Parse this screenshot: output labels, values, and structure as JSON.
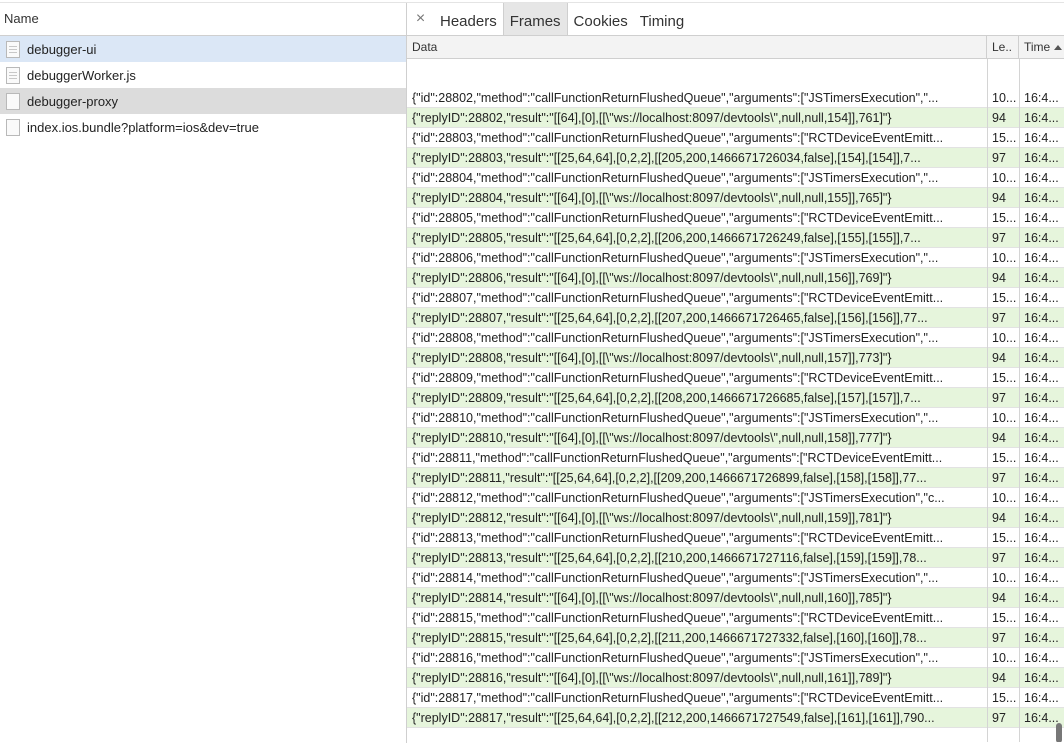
{
  "left_panel": {
    "header": "Name",
    "files": [
      {
        "name": "debugger-ui",
        "state": "selected"
      },
      {
        "name": "debuggerWorker.js",
        "state": ""
      },
      {
        "name": "debugger-proxy",
        "state": "hover"
      },
      {
        "name": "index.ios.bundle?platform=ios&dev=true",
        "state": ""
      }
    ]
  },
  "tabs": {
    "close_icon": "×",
    "items": [
      "Headers",
      "Frames",
      "Cookies",
      "Timing"
    ],
    "active": "Frames"
  },
  "columns": {
    "data": "Data",
    "length": "Le..",
    "time": "Time"
  },
  "frames": [
    {
      "data": "{\"id\":28802,\"method\":\"callFunctionReturnFlushedQueue\",\"arguments\":[\"JSTimersExecution\",\"...",
      "length": "10...",
      "time": "16:4...",
      "kind": "sent"
    },
    {
      "data": "{\"replyID\":28802,\"result\":\"[[64],[0],[[\\\"ws://localhost:8097/devtools\\\",null,null,154]],761]\"}",
      "length": "94",
      "time": "16:4...",
      "kind": "recv"
    },
    {
      "data": "{\"id\":28803,\"method\":\"callFunctionReturnFlushedQueue\",\"arguments\":[\"RCTDeviceEventEmitt...",
      "length": "15...",
      "time": "16:4...",
      "kind": "sent"
    },
    {
      "data": "{\"replyID\":28803,\"result\":\"[[25,64,64],[0,2,2],[[205,200,1466671726034,false],[154],[154]],7...",
      "length": "97",
      "time": "16:4...",
      "kind": "recv"
    },
    {
      "data": "{\"id\":28804,\"method\":\"callFunctionReturnFlushedQueue\",\"arguments\":[\"JSTimersExecution\",\"...",
      "length": "10...",
      "time": "16:4...",
      "kind": "sent"
    },
    {
      "data": "{\"replyID\":28804,\"result\":\"[[64],[0],[[\\\"ws://localhost:8097/devtools\\\",null,null,155]],765]\"}",
      "length": "94",
      "time": "16:4...",
      "kind": "recv"
    },
    {
      "data": "{\"id\":28805,\"method\":\"callFunctionReturnFlushedQueue\",\"arguments\":[\"RCTDeviceEventEmitt...",
      "length": "15...",
      "time": "16:4...",
      "kind": "sent"
    },
    {
      "data": "{\"replyID\":28805,\"result\":\"[[25,64,64],[0,2,2],[[206,200,1466671726249,false],[155],[155]],7...",
      "length": "97",
      "time": "16:4...",
      "kind": "recv"
    },
    {
      "data": "{\"id\":28806,\"method\":\"callFunctionReturnFlushedQueue\",\"arguments\":[\"JSTimersExecution\",\"...",
      "length": "10...",
      "time": "16:4...",
      "kind": "sent"
    },
    {
      "data": "{\"replyID\":28806,\"result\":\"[[64],[0],[[\\\"ws://localhost:8097/devtools\\\",null,null,156]],769]\"}",
      "length": "94",
      "time": "16:4...",
      "kind": "recv"
    },
    {
      "data": "{\"id\":28807,\"method\":\"callFunctionReturnFlushedQueue\",\"arguments\":[\"RCTDeviceEventEmitt...",
      "length": "15...",
      "time": "16:4...",
      "kind": "sent"
    },
    {
      "data": "{\"replyID\":28807,\"result\":\"[[25,64,64],[0,2,2],[[207,200,1466671726465,false],[156],[156]],77...",
      "length": "97",
      "time": "16:4...",
      "kind": "recv"
    },
    {
      "data": "{\"id\":28808,\"method\":\"callFunctionReturnFlushedQueue\",\"arguments\":[\"JSTimersExecution\",\"...",
      "length": "10...",
      "time": "16:4...",
      "kind": "sent"
    },
    {
      "data": "{\"replyID\":28808,\"result\":\"[[64],[0],[[\\\"ws://localhost:8097/devtools\\\",null,null,157]],773]\"}",
      "length": "94",
      "time": "16:4...",
      "kind": "recv"
    },
    {
      "data": "{\"id\":28809,\"method\":\"callFunctionReturnFlushedQueue\",\"arguments\":[\"RCTDeviceEventEmitt...",
      "length": "15...",
      "time": "16:4...",
      "kind": "sent"
    },
    {
      "data": "{\"replyID\":28809,\"result\":\"[[25,64,64],[0,2,2],[[208,200,1466671726685,false],[157],[157]],7...",
      "length": "97",
      "time": "16:4...",
      "kind": "recv"
    },
    {
      "data": "{\"id\":28810,\"method\":\"callFunctionReturnFlushedQueue\",\"arguments\":[\"JSTimersExecution\",\"...",
      "length": "10...",
      "time": "16:4...",
      "kind": "sent"
    },
    {
      "data": "{\"replyID\":28810,\"result\":\"[[64],[0],[[\\\"ws://localhost:8097/devtools\\\",null,null,158]],777]\"}",
      "length": "94",
      "time": "16:4...",
      "kind": "recv"
    },
    {
      "data": "{\"id\":28811,\"method\":\"callFunctionReturnFlushedQueue\",\"arguments\":[\"RCTDeviceEventEmitt...",
      "length": "15...",
      "time": "16:4...",
      "kind": "sent"
    },
    {
      "data": "{\"replyID\":28811,\"result\":\"[[25,64,64],[0,2,2],[[209,200,1466671726899,false],[158],[158]],77...",
      "length": "97",
      "time": "16:4...",
      "kind": "recv"
    },
    {
      "data": "{\"id\":28812,\"method\":\"callFunctionReturnFlushedQueue\",\"arguments\":[\"JSTimersExecution\",\"c...",
      "length": "10...",
      "time": "16:4...",
      "kind": "sent"
    },
    {
      "data": "{\"replyID\":28812,\"result\":\"[[64],[0],[[\\\"ws://localhost:8097/devtools\\\",null,null,159]],781]\"}",
      "length": "94",
      "time": "16:4...",
      "kind": "recv"
    },
    {
      "data": "{\"id\":28813,\"method\":\"callFunctionReturnFlushedQueue\",\"arguments\":[\"RCTDeviceEventEmitt...",
      "length": "15...",
      "time": "16:4...",
      "kind": "sent"
    },
    {
      "data": "{\"replyID\":28813,\"result\":\"[[25,64,64],[0,2,2],[[210,200,1466671727116,false],[159],[159]],78...",
      "length": "97",
      "time": "16:4...",
      "kind": "recv"
    },
    {
      "data": "{\"id\":28814,\"method\":\"callFunctionReturnFlushedQueue\",\"arguments\":[\"JSTimersExecution\",\"...",
      "length": "10...",
      "time": "16:4...",
      "kind": "sent"
    },
    {
      "data": "{\"replyID\":28814,\"result\":\"[[64],[0],[[\\\"ws://localhost:8097/devtools\\\",null,null,160]],785]\"}",
      "length": "94",
      "time": "16:4...",
      "kind": "recv"
    },
    {
      "data": "{\"id\":28815,\"method\":\"callFunctionReturnFlushedQueue\",\"arguments\":[\"RCTDeviceEventEmitt...",
      "length": "15...",
      "time": "16:4...",
      "kind": "sent"
    },
    {
      "data": "{\"replyID\":28815,\"result\":\"[[25,64,64],[0,2,2],[[211,200,1466671727332,false],[160],[160]],78...",
      "length": "97",
      "time": "16:4...",
      "kind": "recv"
    },
    {
      "data": "{\"id\":28816,\"method\":\"callFunctionReturnFlushedQueue\",\"arguments\":[\"JSTimersExecution\",\"...",
      "length": "10...",
      "time": "16:4...",
      "kind": "sent"
    },
    {
      "data": "{\"replyID\":28816,\"result\":\"[[64],[0],[[\\\"ws://localhost:8097/devtools\\\",null,null,161]],789]\"}",
      "length": "94",
      "time": "16:4...",
      "kind": "recv"
    },
    {
      "data": "{\"id\":28817,\"method\":\"callFunctionReturnFlushedQueue\",\"arguments\":[\"RCTDeviceEventEmitt...",
      "length": "15...",
      "time": "16:4...",
      "kind": "sent"
    },
    {
      "data": "{\"replyID\":28817,\"result\":\"[[25,64,64],[0,2,2],[[212,200,1466671727549,false],[161],[161]],790...",
      "length": "97",
      "time": "16:4...",
      "kind": "recv"
    }
  ],
  "colors": {
    "received_row": "#e6f5dc",
    "selected_file": "#dbe7f6",
    "hover_file": "#dcdcdc"
  }
}
